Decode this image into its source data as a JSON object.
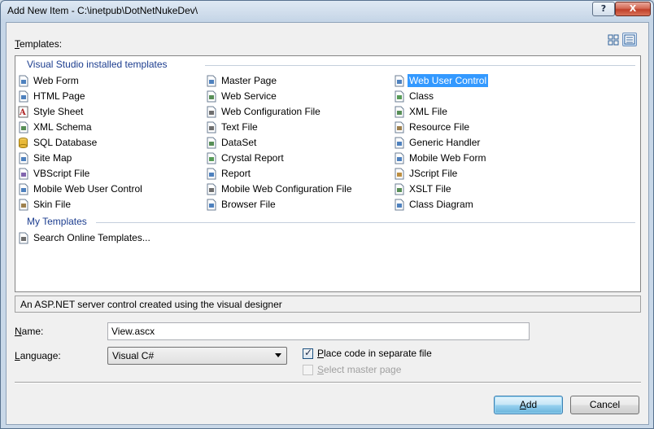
{
  "window": {
    "title": "Add New Item - C:\\inetpub\\DotNetNukeDev\\",
    "help_label": "?",
    "close_label": "X"
  },
  "templates_label": "Templates:",
  "view_icons": [
    "large-icons-view-icon",
    "small-icons-view-icon"
  ],
  "groups": [
    {
      "header": "Visual Studio installed templates",
      "columns": [
        [
          {
            "label": "Web Form",
            "icon": "web-form-icon"
          },
          {
            "label": "HTML Page",
            "icon": "html-page-icon"
          },
          {
            "label": "Style Sheet",
            "icon": "style-sheet-icon"
          },
          {
            "label": "XML Schema",
            "icon": "xml-schema-icon"
          },
          {
            "label": "SQL Database",
            "icon": "sql-database-icon"
          },
          {
            "label": "Site Map",
            "icon": "site-map-icon"
          },
          {
            "label": "VBScript File",
            "icon": "vbscript-file-icon"
          },
          {
            "label": "Mobile Web User Control",
            "icon": "mobile-web-user-control-icon"
          },
          {
            "label": "Skin File",
            "icon": "skin-file-icon"
          }
        ],
        [
          {
            "label": "Master Page",
            "icon": "master-page-icon"
          },
          {
            "label": "Web Service",
            "icon": "web-service-icon"
          },
          {
            "label": "Web Configuration File",
            "icon": "web-config-icon"
          },
          {
            "label": "Text File",
            "icon": "text-file-icon"
          },
          {
            "label": "DataSet",
            "icon": "dataset-icon"
          },
          {
            "label": "Crystal Report",
            "icon": "crystal-report-icon"
          },
          {
            "label": "Report",
            "icon": "report-icon"
          },
          {
            "label": "Mobile Web Configuration File",
            "icon": "mobile-web-config-icon"
          },
          {
            "label": "Browser File",
            "icon": "browser-file-icon"
          }
        ],
        [
          {
            "label": "Web User Control",
            "icon": "web-user-control-icon",
            "selected": true
          },
          {
            "label": "Class",
            "icon": "class-icon"
          },
          {
            "label": "XML File",
            "icon": "xml-file-icon"
          },
          {
            "label": "Resource File",
            "icon": "resource-file-icon"
          },
          {
            "label": "Generic Handler",
            "icon": "generic-handler-icon"
          },
          {
            "label": "Mobile Web Form",
            "icon": "mobile-web-form-icon"
          },
          {
            "label": "JScript File",
            "icon": "jscript-file-icon"
          },
          {
            "label": "XSLT File",
            "icon": "xslt-file-icon"
          },
          {
            "label": "Class Diagram",
            "icon": "class-diagram-icon"
          }
        ]
      ]
    },
    {
      "header": "My Templates",
      "columns": [
        [
          {
            "label": "Search Online Templates...",
            "icon": "search-online-icon"
          }
        ]
      ]
    }
  ],
  "description": "An ASP.NET server control created using the visual designer",
  "name_field": {
    "label": "Name:",
    "value": "View.ascx"
  },
  "language_field": {
    "label": "Language:",
    "value": "Visual C#"
  },
  "place_code": {
    "label": "Place code in separate file",
    "checked": true
  },
  "master_page": {
    "label": "Select master page",
    "checked": false,
    "disabled": true
  },
  "buttons": {
    "add": "Add",
    "cancel": "Cancel"
  },
  "colors": {
    "selection": "#3399ff",
    "group_header": "#1c3d8f"
  }
}
